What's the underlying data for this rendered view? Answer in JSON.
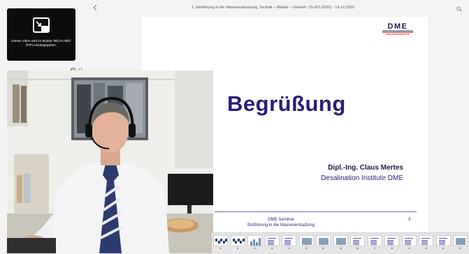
{
  "header": {
    "title": "1. Einführung in die Wasserentsalzung, Technik – Märkte – Umwelt - (S-001-2020) - 14.12.2020"
  },
  "pip": {
    "message": "Dieses Video wird im Modus \"Bild im Bild\" (PiP) wiedergegeben."
  },
  "slide": {
    "logo_text": "DME",
    "logo_sub": "DESALINATION INSTITUTE",
    "title": "Begrüßung",
    "speaker_name": "Dipl.-Ing. Claus Mertes",
    "speaker_org": "Desalination Institute DME",
    "footer_line1": "DME-Seminar",
    "footer_line2": "Einführung in die Wasserentsalzung",
    "page_number": "3"
  },
  "filmstrip": {
    "thumbnails": [
      {
        "label": "8",
        "kind": "map"
      },
      {
        "label": "9",
        "kind": "map"
      },
      {
        "label": "10",
        "kind": "chart"
      },
      {
        "label": "11",
        "kind": "text"
      },
      {
        "label": "12",
        "kind": "text"
      },
      {
        "label": "13",
        "kind": "photo"
      },
      {
        "label": "14",
        "kind": "photo"
      },
      {
        "label": "15",
        "kind": "photo"
      },
      {
        "label": "16",
        "kind": "text"
      },
      {
        "label": "17",
        "kind": "text"
      },
      {
        "label": "18",
        "kind": "text"
      },
      {
        "label": "19",
        "kind": "text"
      },
      {
        "label": "20",
        "kind": "text"
      },
      {
        "label": "21",
        "kind": "text"
      },
      {
        "label": "22",
        "kind": "photo"
      }
    ]
  },
  "colors": {
    "slide_title": "#2a1d7a",
    "dme_red": "#c0282d",
    "dme_navy": "#1e1b4b"
  }
}
